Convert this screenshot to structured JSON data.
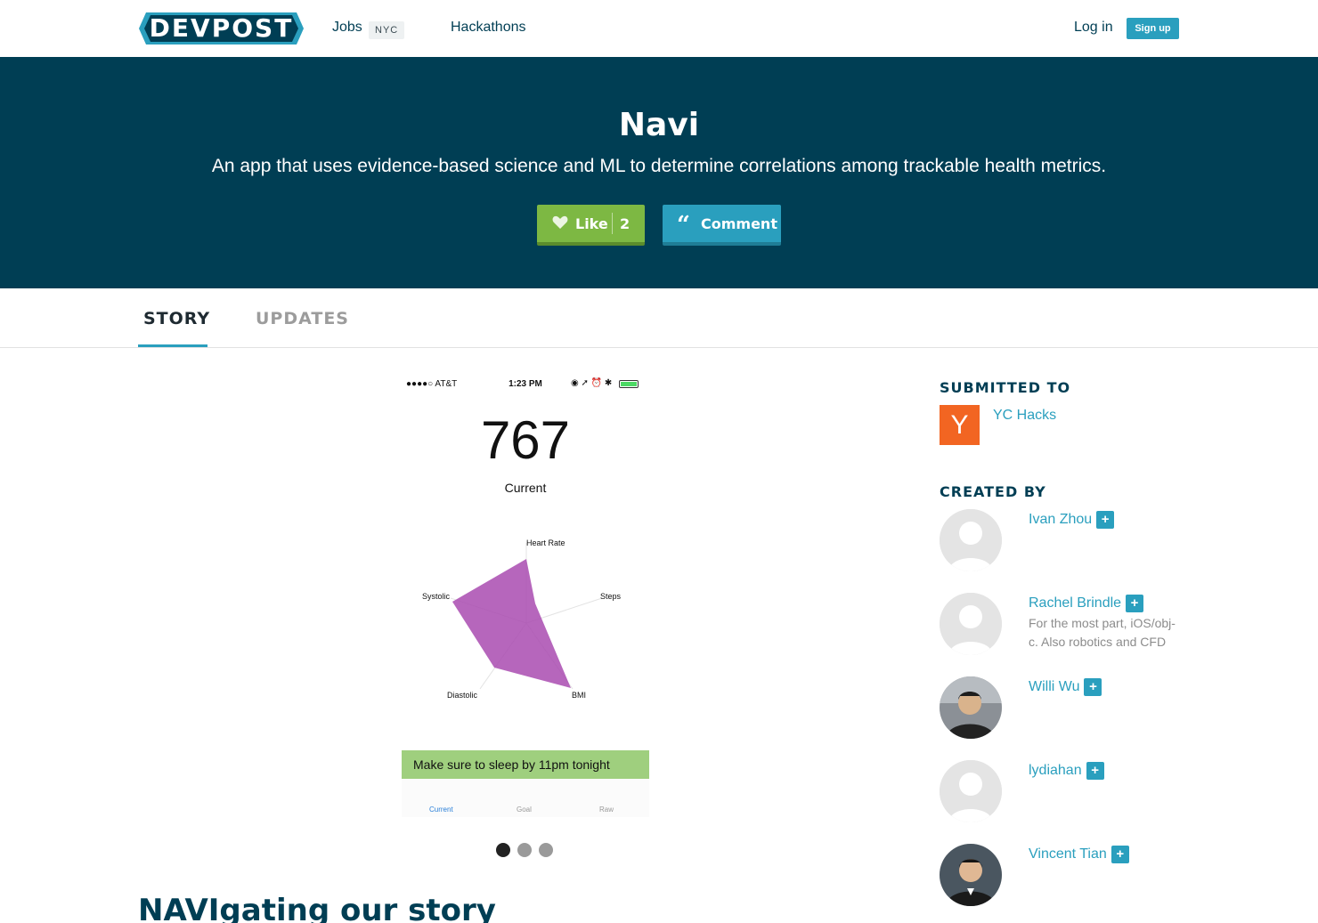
{
  "nav": {
    "logo": "DEVPOST",
    "jobs_label": "Jobs",
    "jobs_badge": "NYC",
    "hackathons_label": "Hackathons",
    "login_label": "Log in",
    "signup_label": "Sign up"
  },
  "hero": {
    "title": "Navi",
    "tagline": "An app that uses evidence-based science and ML to determine correlations among trackable health metrics.",
    "like_label": "Like",
    "like_count": "2",
    "comment_label": "Comment"
  },
  "tabs": [
    {
      "label": "STORY",
      "active": true
    },
    {
      "label": "UPDATES",
      "active": false
    }
  ],
  "gallery": {
    "status_carrier": "●●●●○ AT&T",
    "status_time": "1:23 PM",
    "big_number": "767",
    "big_sub": "Current",
    "radar_labels": [
      "Heart Rate",
      "Steps",
      "BMI",
      "Diastolic",
      "Systolic"
    ],
    "tip_text": "Make sure to sleep by 11pm tonight",
    "phone_tabs": [
      "Current",
      "Goal",
      "Raw"
    ],
    "slide_count": 3,
    "active_slide": 1
  },
  "story": {
    "heading": "NAVIgating our story"
  },
  "sidebar": {
    "submitted_title": "SUBMITTED TO",
    "hackathon_logo": "Y",
    "hackathon_name": "YC Hacks",
    "created_title": "CREATED BY",
    "members": [
      {
        "name": "Ivan Zhou",
        "bio": ""
      },
      {
        "name": "Rachel Brindle",
        "bio": "For the most part, iOS/obj-c. Also robotics and CFD"
      },
      {
        "name": "Willi Wu",
        "bio": ""
      },
      {
        "name": "lydiahan",
        "bio": ""
      },
      {
        "name": "Vincent Tian",
        "bio": ""
      }
    ],
    "follow_symbol": "+"
  },
  "colors": {
    "navy": "#003e54",
    "teal": "#2a9fbe",
    "like_green": "#7db843",
    "yc_orange": "#f26522",
    "radar_purple": "#a94bb0"
  }
}
